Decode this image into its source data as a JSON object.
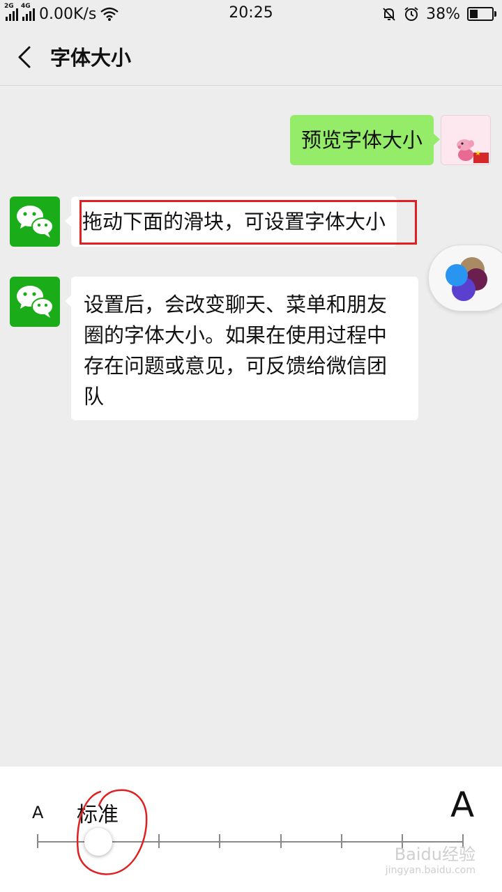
{
  "status_bar": {
    "network_1": "2G",
    "network_2": "4G",
    "speed": "0.00K/s",
    "time": "20:25",
    "battery_percent": "38%",
    "battery_level": 0.38,
    "icons": [
      "signal-icon",
      "wifi-icon",
      "mute-icon",
      "alarm-icon",
      "battery-icon"
    ]
  },
  "header": {
    "title": "字体大小",
    "back_icon": "chevron-left-icon"
  },
  "messages": [
    {
      "side": "out",
      "text": "预览字体大小"
    },
    {
      "side": "in",
      "text": "拖动下面的滑块，可设置字体大小"
    },
    {
      "side": "in",
      "text": "设置后，会改变聊天、菜单和朋友圈的字体大小。如果在使用过程中存在问题或意见，可反馈给微信团队"
    }
  ],
  "font_slider": {
    "small_label": "A",
    "large_label": "A",
    "current_level": "标准",
    "position_index": 1,
    "total_steps": 8
  },
  "watermark": {
    "brand": "Baidu经验",
    "url": "jingyan.baidu.com"
  },
  "colors": {
    "background": "#ededed",
    "outgoing_bubble": "#95ec69",
    "incoming_bubble": "#ffffff",
    "wechat_green": "#1aad19",
    "annotation_red": "#e02020"
  }
}
